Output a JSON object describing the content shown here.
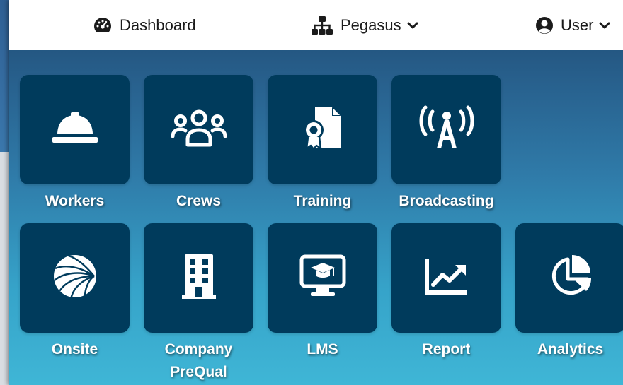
{
  "nav": {
    "dashboard": {
      "label": "Dashboard",
      "icon": "tachometer-icon"
    },
    "org": {
      "label": "Pegasus",
      "icon": "sitemap-icon"
    },
    "user": {
      "label": "User",
      "icon": "user-circle-icon"
    }
  },
  "tiles": [
    {
      "label": "Workers",
      "icon": "hard-hat-icon"
    },
    {
      "label": "Crews",
      "icon": "users-icon"
    },
    {
      "label": "Training",
      "icon": "certificate-file-icon"
    },
    {
      "label": "Broadcasting",
      "icon": "broadcast-tower-icon"
    },
    {
      "label": "Onsite",
      "icon": "globe-icon"
    },
    {
      "label": "Company PreQual",
      "icon": "building-icon"
    },
    {
      "label": "LMS",
      "icon": "graduation-monitor-icon"
    },
    {
      "label": "Report",
      "icon": "line-chart-icon"
    },
    {
      "label": "Analytics",
      "icon": "pie-chart-icon"
    }
  ],
  "colors": {
    "tile": "#003b5c",
    "topbar": "#ffffff",
    "gradient_top": "#1f4a72",
    "gradient_bottom": "#3fb6d6"
  }
}
